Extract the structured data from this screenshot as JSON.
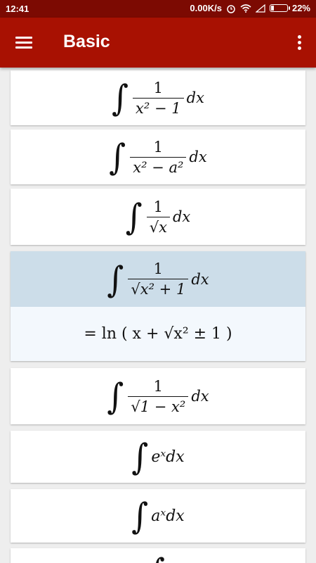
{
  "status_bar": {
    "time": "12:41",
    "net_speed": "0.00K/s",
    "battery_pct": "22%",
    "battery_level": 0.22
  },
  "app_bar": {
    "title": "Basic",
    "menu_icon": "hamburger-menu-icon",
    "more_icon": "more-vert-icon"
  },
  "colors": {
    "status_bar": "#7c0a02",
    "app_bar": "#a81102",
    "selected_card": "#ccdde9",
    "answer_bg": "#f3f8fd"
  },
  "formulas": [
    {
      "integral": "∫",
      "numerator": "1",
      "denominator": "x² − 1",
      "differential": "dx"
    },
    {
      "integral": "∫",
      "numerator": "1",
      "denominator": "x² − a²",
      "differential": "dx"
    },
    {
      "integral": "∫",
      "numerator": "1",
      "denominator": "√x",
      "differential": "dx"
    },
    {
      "integral": "∫",
      "numerator": "1",
      "denominator": "√x² + 1",
      "differential": "dx",
      "answer": "= ln ( x + √x² ± 1 )"
    },
    {
      "integral": "∫",
      "numerator": "1",
      "denominator": "√1 − x²",
      "differential": "dx"
    },
    {
      "integral": "∫",
      "expression": "eˣdx"
    },
    {
      "integral": "∫",
      "expression": "aˣdx"
    },
    {
      "integral": "∫"
    }
  ]
}
